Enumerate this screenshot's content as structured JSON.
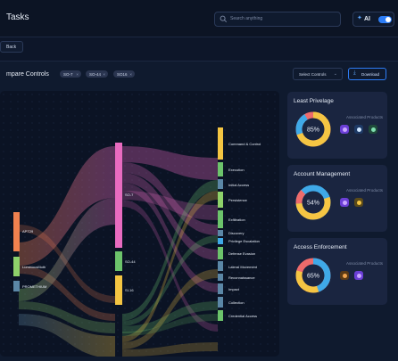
{
  "header": {
    "title": "Tasks",
    "search_placeholder": "Search anything",
    "ai_label": "AI"
  },
  "back_label": "Back",
  "compare": {
    "title": "mpare Controls",
    "chips": [
      "SO-7",
      "SO-44",
      "SO16"
    ],
    "select_label": "Select Controls",
    "download_label": "Download"
  },
  "sankey": {
    "sources": [
      "APT29",
      "LuminousMoth",
      "PROMETHIUM"
    ],
    "controls": [
      "SO-7",
      "SO-44",
      "SI-16"
    ],
    "tactics": [
      "Command & Control",
      "Execution",
      "Initial Access",
      "Persistence",
      "Exfiltration",
      "Discovery",
      "Privilege Escalation",
      "Defense Evasion",
      "Lateral Movement",
      "Reconnaissance",
      "Impact",
      "Collection",
      "Credential Access"
    ]
  },
  "cards": [
    {
      "title": "Least Privelage",
      "percent": "85%",
      "value": 85,
      "associated_label": "Associated Products"
    },
    {
      "title": "Account Management",
      "percent": "54%",
      "value": 54,
      "associated_label": "Associated Products"
    },
    {
      "title": "Access Enforcement",
      "percent": "65%",
      "value": 65,
      "associated_label": "Associated Products"
    }
  ],
  "colors": {
    "accent": "#2d7df6",
    "apt29": "#f0814f",
    "luminous": "#8ed16a",
    "promethium": "#5b87a6",
    "so7": "#e86bc0",
    "so44": "#6cc36b",
    "si16": "#f4c542",
    "donut_blue": "#3fa9e8",
    "donut_yellow": "#f5c543",
    "donut_red": "#ee6b6b"
  }
}
